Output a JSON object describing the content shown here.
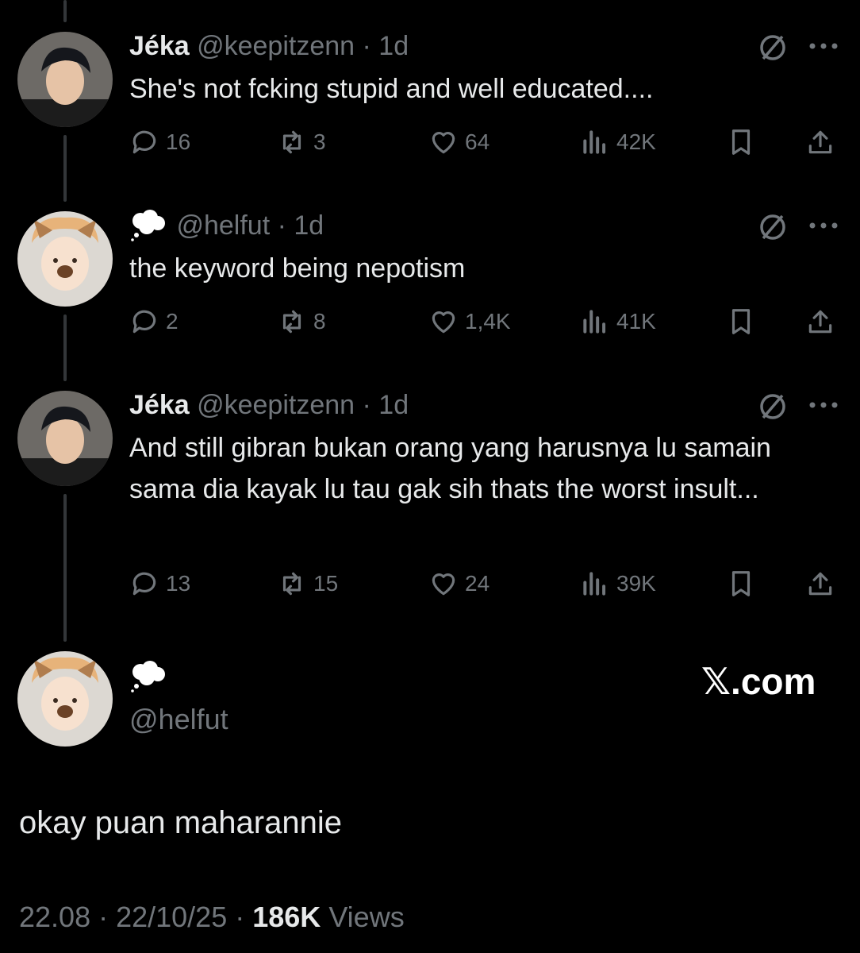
{
  "tweets": [
    {
      "name": "Jéka",
      "handle": "@keepitzenn",
      "time": "· 1d",
      "text": "She's not fcking stupid and well educated....",
      "replies": "16",
      "reposts": "3",
      "likes": "64",
      "views": "42K"
    },
    {
      "name": "",
      "handle": "@helfut",
      "time": "· 1d",
      "text": "the keyword being nepotism",
      "replies": "2",
      "reposts": "8",
      "likes": "1,4K",
      "views": "41K"
    },
    {
      "name": "Jéka",
      "handle": "@keepitzenn",
      "time": "· 1d",
      "text": "And still gibran bukan orang yang harusnya lu samain sama dia kayak lu tau gak sih thats the worst insult...",
      "replies": "13",
      "reposts": "15",
      "likes": "24",
      "views": "39K"
    }
  ],
  "main_post": {
    "handle": "@helfut",
    "site_label": "𝕏.com",
    "text": "okay puan maharannie",
    "time": "22.08",
    "date": "22/10/25",
    "views_count": "186K",
    "views_label": "Views"
  },
  "icons": {
    "cloud": "thought-balloon-icon",
    "mute": "not-interested-icon",
    "more": "more-dots-icon",
    "reply": "reply-bubble-icon",
    "repost": "repost-icon",
    "like": "heart-icon",
    "views": "views-bars-icon",
    "bookmark": "bookmark-icon",
    "share": "share-icon"
  },
  "colors": {
    "background": "#000000",
    "text": "#e7e9ea",
    "muted": "#71767b"
  }
}
